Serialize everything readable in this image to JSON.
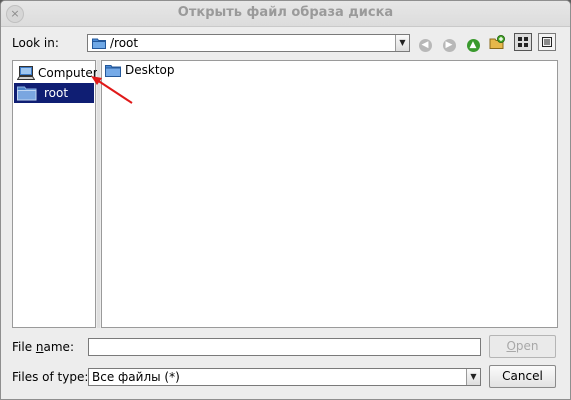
{
  "window": {
    "title": "Открыть файл образа диска",
    "close_glyph": "×"
  },
  "toolbar": {
    "look_in_label": "Look in:",
    "path": "/root"
  },
  "sidebar": {
    "items": [
      {
        "label": "Computer",
        "icon": "computer-icon",
        "selected": false
      },
      {
        "label": "root",
        "icon": "folder-icon",
        "selected": true
      }
    ]
  },
  "file_list": {
    "items": [
      {
        "name": "Desktop",
        "icon": "folder-icon"
      }
    ]
  },
  "form": {
    "file_name_label_pre": "File ",
    "file_name_label_ul": "n",
    "file_name_label_post": "ame:",
    "file_name_value": "",
    "file_type_label": "Files of type:",
    "file_type_value": "Все файлы (*)"
  },
  "buttons": {
    "open_ul": "O",
    "open_rest": "pen",
    "cancel": "Cancel"
  },
  "colors": {
    "selection": "#0f1e73",
    "annotation_arrow": "#e01919"
  }
}
